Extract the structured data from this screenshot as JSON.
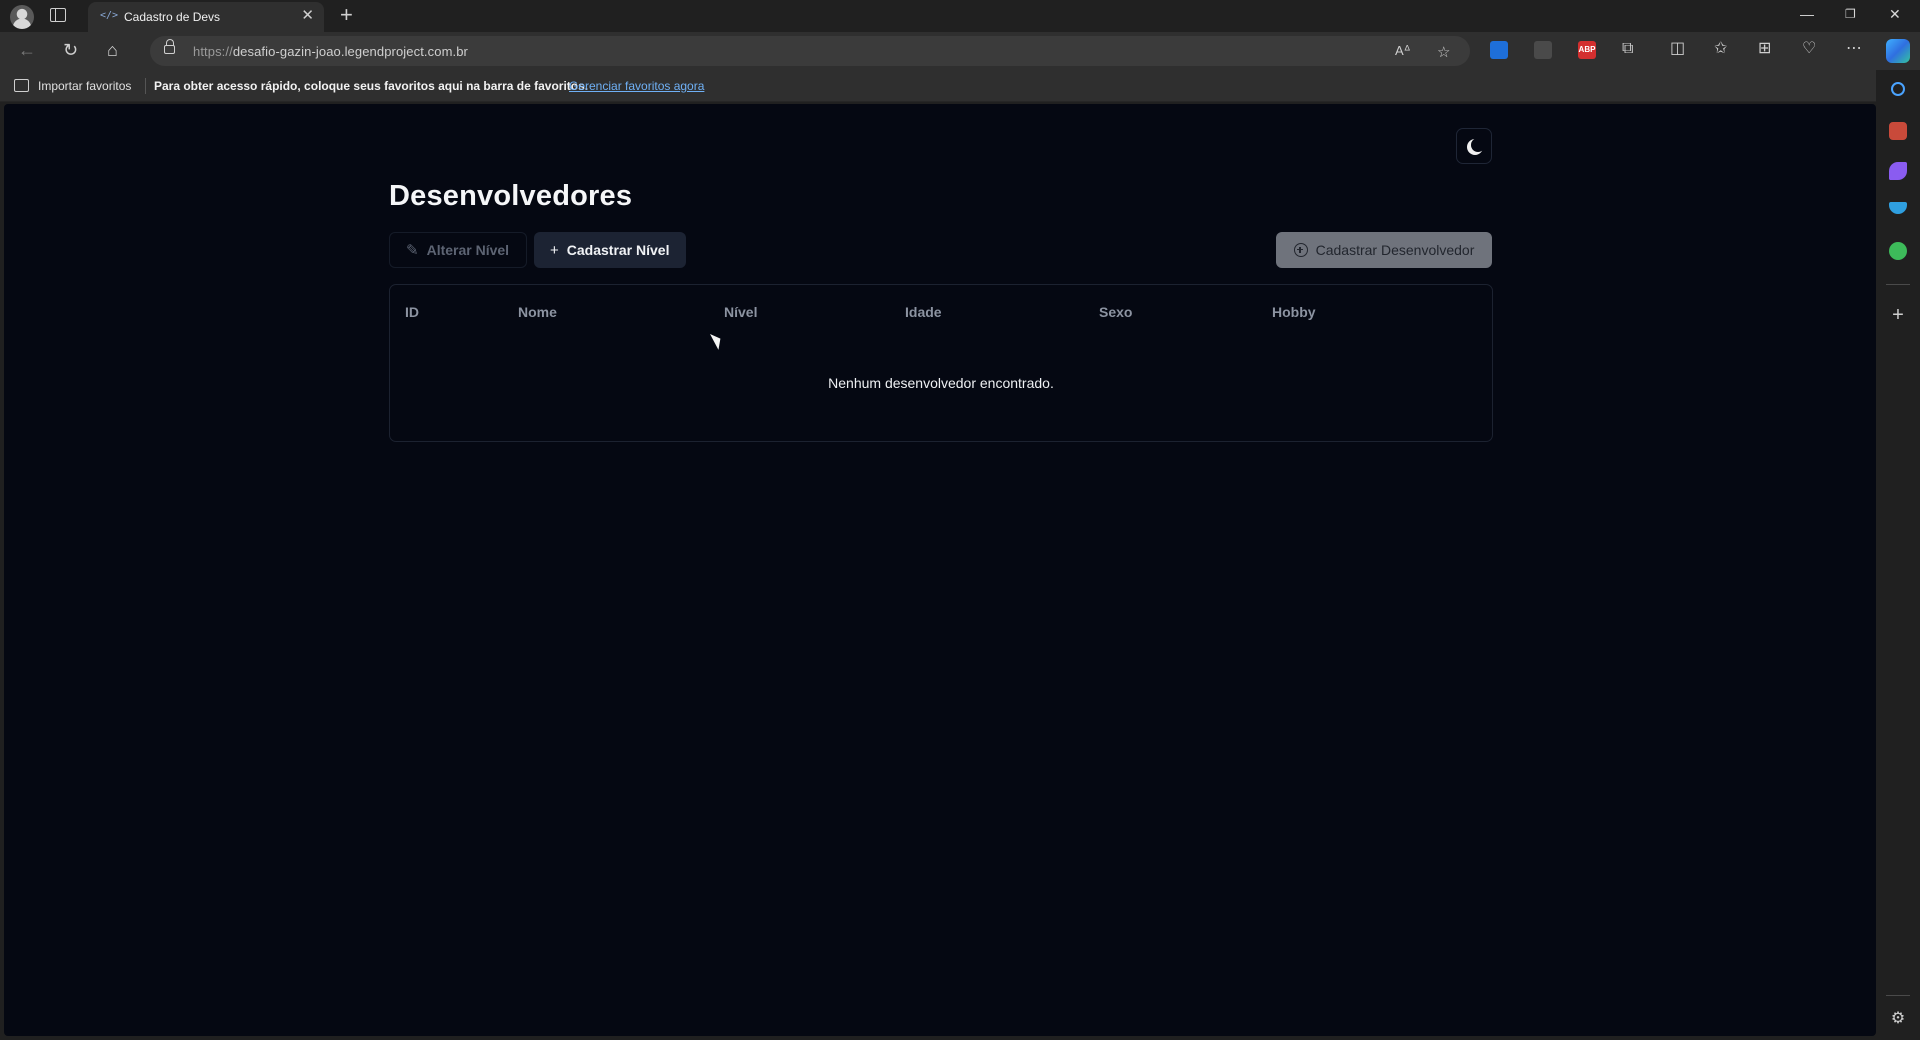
{
  "browser": {
    "tab_title": "Cadastro de Devs",
    "tab_favicon": "</>",
    "url_scheme": "https://",
    "url_host": "desafio-gazin-joao.legendproject.com.br",
    "favorites": {
      "import_label": "Importar favoritos",
      "message": "Para obter acesso rápido, coloque seus favoritos aqui na barra de favoritos.",
      "manage_link": "Gerenciar favoritos agora"
    },
    "extensions": [
      {
        "name": "bitwarden-extension",
        "color": "#1e6fd9",
        "label": ""
      },
      {
        "name": "extension-2",
        "color": "#3a3a3a",
        "label": ""
      },
      {
        "name": "adblock-plus-extension",
        "color": "#d32f2f",
        "label": "ABP"
      }
    ]
  },
  "page": {
    "title": "Desenvolvedores",
    "buttons": {
      "alter_level": "Alterar Nível",
      "register_level": "Cadastrar Nível",
      "register_developer": "Cadastrar Desenvolvedor"
    },
    "table": {
      "columns": [
        "ID",
        "Nome",
        "Nível",
        "Idade",
        "Sexo",
        "Hobby"
      ],
      "empty_message": "Nenhum desenvolvedor encontrado."
    }
  },
  "icons": [
    "profile-avatar-icon",
    "tab-actions-icon",
    "code-favicon-icon",
    "close-icon",
    "plus-icon",
    "back-icon",
    "refresh-icon",
    "home-icon",
    "lock-icon",
    "read-aloud-icon",
    "star-icon",
    "extensions-icon",
    "split-screen-icon",
    "favorites-icon",
    "collections-icon",
    "health-icon",
    "more-icon",
    "copilot-icon",
    "search-icon",
    "moon-icon",
    "pencil-icon",
    "plus-circle-icon",
    "settings-icon"
  ],
  "colors": {
    "page_background": "#050812",
    "primary_button": "#1c2333",
    "disabled_button": "#6f737c",
    "link": "#6fb0f5"
  }
}
